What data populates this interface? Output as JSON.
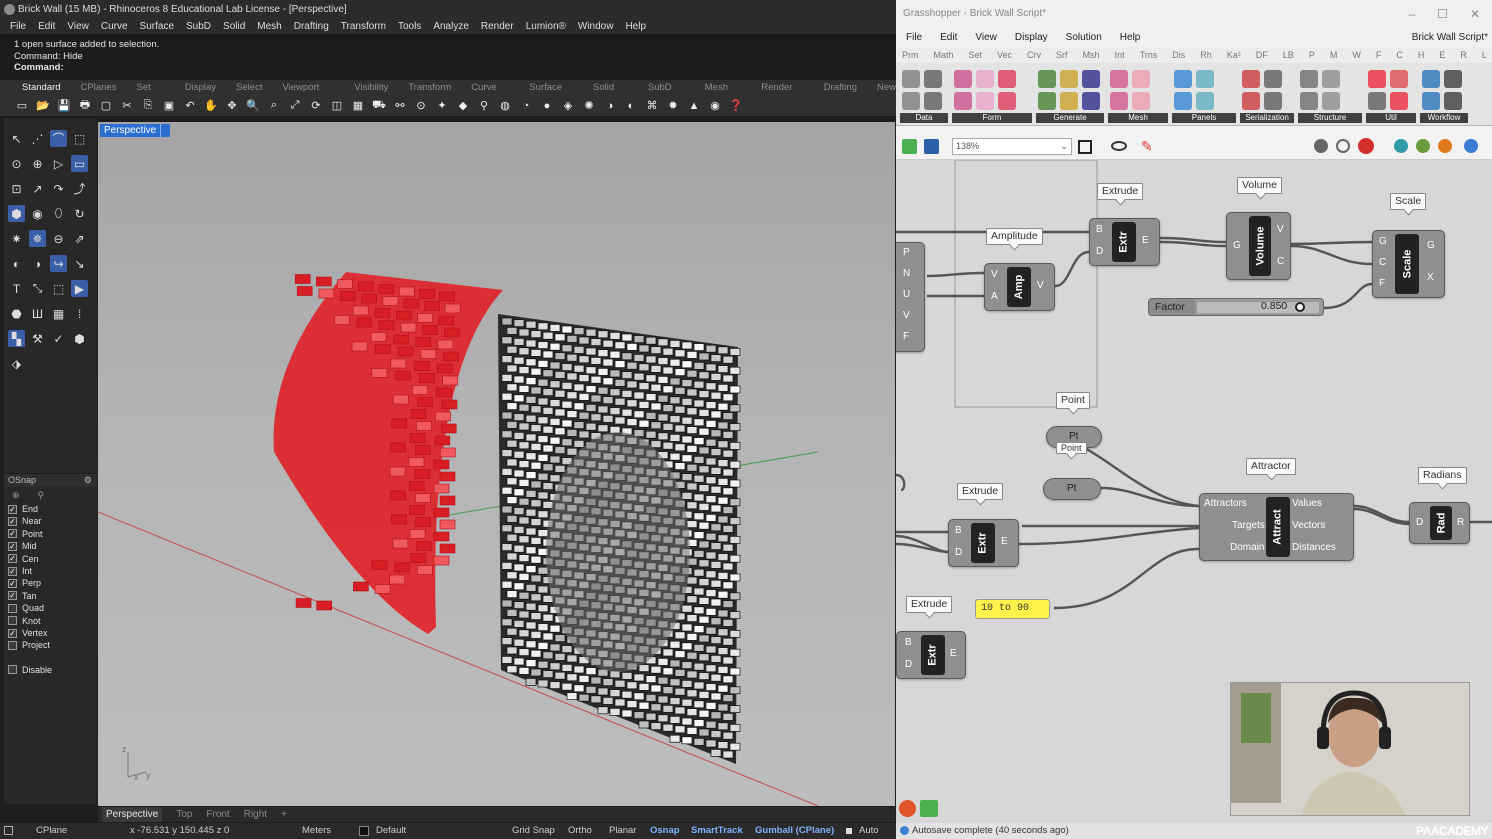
{
  "rhino": {
    "title": "Brick Wall (15 MB) - Rhinoceros 8 Educational Lab License - [Perspective]",
    "menu": [
      "File",
      "Edit",
      "View",
      "Curve",
      "Surface",
      "SubD",
      "Solid",
      "Mesh",
      "Drafting",
      "Transform",
      "Tools",
      "Analyze",
      "Render",
      "Lumion®",
      "Window",
      "Help"
    ],
    "command_history": [
      "1 open surface added to selection.",
      "Command: Hide"
    ],
    "command_prompt": "Command:",
    "toolbar_tabs": [
      "Standard",
      "CPlanes",
      "Set View",
      "Display",
      "Select",
      "Viewport Layout",
      "Visibility",
      "Transform",
      "Curve Tools",
      "Surface Tools",
      "Solid Tools",
      "SubD Tools",
      "Mesh Tools",
      "Render Tools",
      "Drafting",
      "New"
    ],
    "viewport_label": "Perspective",
    "viewport_tabs": [
      "Perspective",
      "Top",
      "Front",
      "Right",
      "+"
    ],
    "osnap": {
      "title": "OSnap",
      "items": [
        {
          "label": "End",
          "checked": true
        },
        {
          "label": "Near",
          "checked": true
        },
        {
          "label": "Point",
          "checked": true
        },
        {
          "label": "Mid",
          "checked": true
        },
        {
          "label": "Cen",
          "checked": true
        },
        {
          "label": "Int",
          "checked": true
        },
        {
          "label": "Perp",
          "checked": true
        },
        {
          "label": "Tan",
          "checked": true
        },
        {
          "label": "Quad",
          "checked": false
        },
        {
          "label": "Knot",
          "checked": false
        },
        {
          "label": "Vertex",
          "checked": true
        },
        {
          "label": "Project",
          "checked": false
        }
      ],
      "disable": "Disable"
    },
    "status": {
      "cplane": "CPlane",
      "coords": "x -76.531  y 150.445  z 0",
      "units": "Meters",
      "layer": "Default",
      "grid_snap": "Grid Snap",
      "ortho": "Ortho",
      "planar": "Planar",
      "osnap": "Osnap",
      "smarttrack": "SmartTrack",
      "gumball": "Gumball (CPlane)",
      "auto": "Auto CPl"
    }
  },
  "grasshopper": {
    "title": "Grasshopper - Brick Wall Script*",
    "menu": [
      "File",
      "Edit",
      "View",
      "Display",
      "Solution",
      "Help"
    ],
    "document": "Brick Wall Script*",
    "categories": [
      "Prm",
      "Math",
      "Set",
      "Vec",
      "Crv",
      "Srf",
      "Msh",
      "Int",
      "Trns",
      "Dis",
      "Rh",
      "Ka²",
      "DF",
      "LB",
      "P",
      "M",
      "W",
      "F",
      "C",
      "H",
      "E",
      "R",
      "L"
    ],
    "ribbon_groups": [
      "Data",
      "Form",
      "Generate",
      "Mesh",
      "Panels",
      "Serialization",
      "Structure",
      "Util",
      "Workflow"
    ],
    "zoom": "138%",
    "components": {
      "extrude1": {
        "label": "Extrude",
        "core": "Extr",
        "inputs": [
          "B",
          "D"
        ],
        "outputs": [
          "E"
        ]
      },
      "volume": {
        "label": "Volume",
        "core": "Volume",
        "inputs": [
          "G"
        ],
        "outputs": [
          "V",
          "C"
        ]
      },
      "scale": {
        "label": "Scale",
        "core": "Scale",
        "inputs": [
          "G",
          "C",
          "F"
        ],
        "outputs": [
          "G",
          "X"
        ]
      },
      "amplitude": {
        "label": "Amplitude",
        "core": "Amp",
        "inputs": [
          "V",
          "A"
        ],
        "outputs": [
          "V"
        ]
      },
      "left_params": [
        "P",
        "N",
        "U",
        "V",
        "F"
      ],
      "factor": {
        "label": "Factor",
        "value": "0.850"
      },
      "point1": {
        "label": "Point",
        "core": "Pt"
      },
      "point2": {
        "label": "Point",
        "core": "Pt"
      },
      "attractor": {
        "label": "Attractor",
        "core": "Attract",
        "inputs": [
          "Attractors",
          "Targets",
          "Domain"
        ],
        "outputs": [
          "Values",
          "Vectors",
          "Distances"
        ]
      },
      "radians": {
        "label": "Radians",
        "core": "Rad",
        "inputs": [
          "D"
        ],
        "outputs": [
          "R"
        ]
      },
      "extrude2": {
        "label": "Extrude",
        "core": "Extr",
        "inputs": [
          "B",
          "D"
        ],
        "outputs": [
          "E"
        ]
      },
      "panel": {
        "value": "10 to 90"
      },
      "extrude3": {
        "label": "Extrude",
        "core": "Extr",
        "inputs": [
          "B",
          "D"
        ],
        "outputs": [
          "E"
        ]
      }
    },
    "status": "Autosave complete (40 seconds ago)"
  },
  "brand": "PAACADEMY",
  "colors": {
    "rhino_accent": "#2d6fd1",
    "brick_red": "#e0242a",
    "gh_canvas": "#d7d7d7",
    "panel_yellow": "#fff24a"
  }
}
